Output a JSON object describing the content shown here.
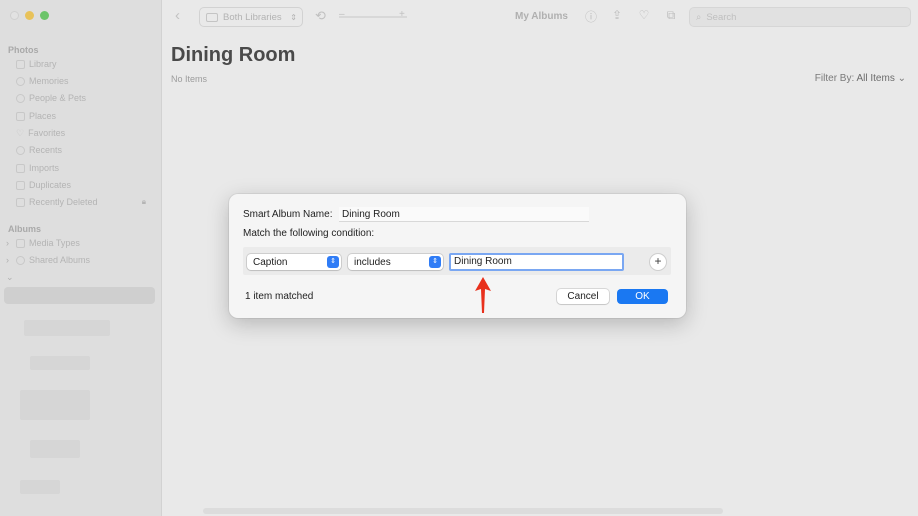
{
  "sidebar": {
    "sections": {
      "photos": "Photos",
      "albums": "Albums"
    },
    "items": [
      {
        "label": "Library",
        "icon": "library-icon"
      },
      {
        "label": "Memories",
        "icon": "memories-icon"
      },
      {
        "label": "People & Pets",
        "icon": "people-icon"
      },
      {
        "label": "Places",
        "icon": "places-icon"
      },
      {
        "label": "Favorites",
        "icon": "heart-icon"
      },
      {
        "label": "Recents",
        "icon": "clock-icon"
      },
      {
        "label": "Imports",
        "icon": "imports-icon"
      },
      {
        "label": "Duplicates",
        "icon": "duplicates-icon"
      },
      {
        "label": "Recently Deleted",
        "icon": "trash-icon"
      }
    ],
    "album_items": [
      {
        "label": "Media Types",
        "icon": "folder-icon"
      },
      {
        "label": "Shared Albums",
        "icon": "cloud-icon"
      }
    ]
  },
  "toolbar": {
    "library_selector": "Both Libraries",
    "title": "My Albums",
    "search_placeholder": "Search"
  },
  "main": {
    "album_title": "Dining Room",
    "status": "No Items",
    "filter_label": "Filter By:",
    "filter_value": "All Items"
  },
  "dialog": {
    "name_label": "Smart Album Name:",
    "name_value": "Dining Room",
    "match_label": "Match the following condition:",
    "field_value": "Caption",
    "operator_value": "includes",
    "text_value": "Dining Room",
    "matched_text": "1 item matched",
    "cancel_label": "Cancel",
    "ok_label": "OK"
  },
  "colors": {
    "accent": "#1a78f2",
    "annotation_arrow": "#e8301c"
  }
}
